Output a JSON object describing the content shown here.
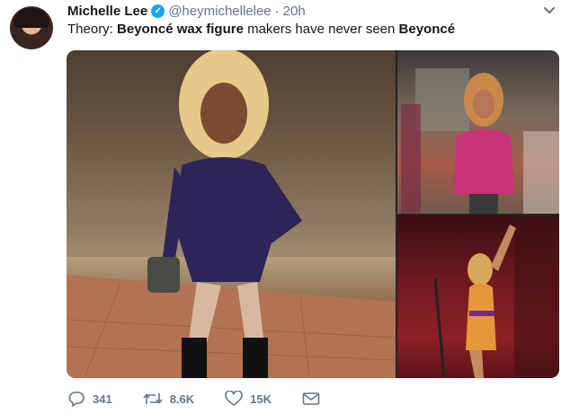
{
  "tweet": {
    "name": "Michelle Lee",
    "handle": "@heymichellelee",
    "separator": "·",
    "time": "20h",
    "text_parts": [
      {
        "text": "Theory: ",
        "bold": false
      },
      {
        "text": "Beyoncé wax figure",
        "bold": true
      },
      {
        "text": " makers have never seen ",
        "bold": false
      },
      {
        "text": "Beyoncé",
        "bold": true
      }
    ]
  },
  "media": {
    "images": [
      {
        "name": "main-photo"
      },
      {
        "name": "top-right-photo"
      },
      {
        "name": "bottom-right-photo"
      }
    ]
  },
  "actions": {
    "replies": "341",
    "retweets": "8.6K",
    "likes": "15K"
  },
  "colors": {
    "verified": "#1da1f2",
    "muted": "#657786",
    "text": "#14171a"
  },
  "icons": [
    "avatar",
    "verified-badge-icon",
    "chevron-down-icon",
    "reply-icon",
    "retweet-icon",
    "like-icon",
    "direct-message-icon"
  ]
}
